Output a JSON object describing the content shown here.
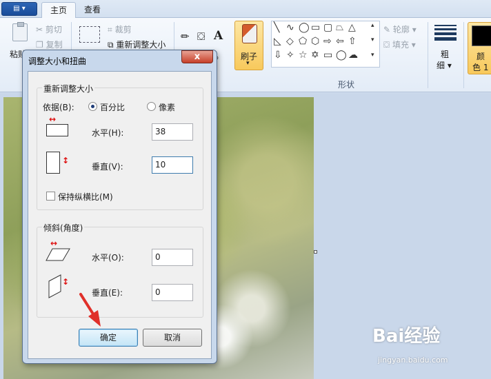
{
  "tabs": {
    "home": "主页",
    "view": "查看"
  },
  "ribbon": {
    "paste": "粘贴",
    "cut": "剪切",
    "copy": "复制",
    "crop": "裁剪",
    "resize": "重新调整大小",
    "brush": "刷子",
    "outline": "轮廓",
    "fill": "填充",
    "shapes_group": "形状",
    "size_line1": "粗",
    "size_line2": "细",
    "color_line1": "颜",
    "color_line2": "色 1"
  },
  "dialog": {
    "title": "调整大小和扭曲",
    "close": "x",
    "resize_legend": "重新调整大小",
    "by_label": "依据(B):",
    "percent_label": "百分比",
    "pixel_label": "像素",
    "selected_mode": "percent",
    "horizontal_label": "水平(H):",
    "horizontal_value": "38",
    "vertical_label": "垂直(V):",
    "vertical_value": "10",
    "keep_ratio_label": "保持纵横比(M)",
    "keep_ratio_checked": false,
    "skew_legend": "倾斜(角度)",
    "skew_h_label": "水平(O):",
    "skew_h_value": "0",
    "skew_v_label": "垂直(E):",
    "skew_v_value": "0",
    "ok": "确定",
    "cancel": "取消"
  },
  "watermark": {
    "brand": "Bai经验",
    "url": "jingyan.baidu.com"
  },
  "colors": {
    "accent_red": "#dd1111",
    "active_button": "#f8c95c",
    "dialog_frame": "#c8d8ec"
  }
}
